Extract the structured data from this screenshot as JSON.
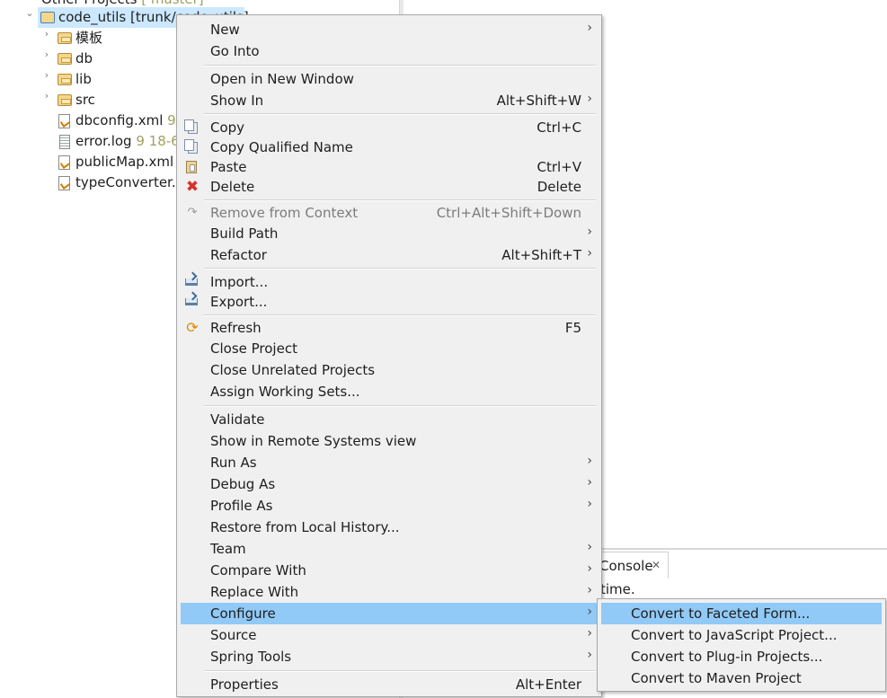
{
  "explorer": {
    "top_row": {
      "label": "Other Projects",
      "deco": "[ master]"
    },
    "project": {
      "label": "code_utils [trunk/code_utils]"
    },
    "items": [
      {
        "label": "模板",
        "deco": "",
        "icon": "folder-icon"
      },
      {
        "label": "db",
        "deco": "",
        "icon": "folder-icon"
      },
      {
        "label": "lib",
        "deco": "",
        "icon": "folder-icon"
      },
      {
        "label": "src",
        "deco": "",
        "icon": "folder-icon"
      },
      {
        "label": "dbconfig.xml",
        "deco": "9",
        "icon": "xml-file-icon"
      },
      {
        "label": "error.log",
        "deco": "9  18-6",
        "icon": "log-file-icon"
      },
      {
        "label": "publicMap.xml",
        "deco": "",
        "icon": "xml-file-icon"
      },
      {
        "label": "typeConverter.xml",
        "deco": "",
        "icon": "xml-file-icon"
      }
    ]
  },
  "console": {
    "tab_label": "Console",
    "close_glyph": "✕",
    "text": "time."
  },
  "menu": {
    "arrow_glyph": "›",
    "items": [
      {
        "label": "New",
        "shortcut": "",
        "submenu": true
      },
      {
        "label": "Go Into",
        "shortcut": ""
      },
      {
        "label": "Open in New Window",
        "shortcut": ""
      },
      {
        "label": "Show In",
        "shortcut": "Alt+Shift+W",
        "submenu": true
      },
      {
        "label": "Copy",
        "shortcut": "Ctrl+C",
        "icon": "copy-icon"
      },
      {
        "label": "Copy Qualified Name",
        "shortcut": "",
        "icon": "copy-icon"
      },
      {
        "label": "Paste",
        "shortcut": "Ctrl+V",
        "icon": "paste-icon"
      },
      {
        "label": "Delete",
        "shortcut": "Delete",
        "icon": "delete-icon"
      },
      {
        "label": "Remove from Context",
        "shortcut": "Ctrl+Alt+Shift+Down",
        "icon": "remove-context-icon",
        "disabled": true
      },
      {
        "label": "Build Path",
        "shortcut": "",
        "submenu": true
      },
      {
        "label": "Refactor",
        "shortcut": "Alt+Shift+T",
        "submenu": true
      },
      {
        "label": "Import...",
        "shortcut": "",
        "icon": "import-icon"
      },
      {
        "label": "Export...",
        "shortcut": "",
        "icon": "export-icon"
      },
      {
        "label": "Refresh",
        "shortcut": "F5",
        "icon": "refresh-icon"
      },
      {
        "label": "Close Project",
        "shortcut": ""
      },
      {
        "label": "Close Unrelated Projects",
        "shortcut": ""
      },
      {
        "label": "Assign Working Sets...",
        "shortcut": ""
      },
      {
        "label": "Validate",
        "shortcut": ""
      },
      {
        "label": "Show in Remote Systems view",
        "shortcut": ""
      },
      {
        "label": "Run As",
        "shortcut": "",
        "submenu": true
      },
      {
        "label": "Debug As",
        "shortcut": "",
        "submenu": true
      },
      {
        "label": "Profile As",
        "shortcut": "",
        "submenu": true
      },
      {
        "label": "Restore from Local History...",
        "shortcut": ""
      },
      {
        "label": "Team",
        "shortcut": "",
        "submenu": true
      },
      {
        "label": "Compare With",
        "shortcut": "",
        "submenu": true
      },
      {
        "label": "Replace With",
        "shortcut": "",
        "submenu": true
      },
      {
        "label": "Configure",
        "shortcut": "",
        "submenu": true,
        "highlighted": true
      },
      {
        "label": "Source",
        "shortcut": "",
        "submenu": true
      },
      {
        "label": "Spring Tools",
        "shortcut": "",
        "submenu": true
      },
      {
        "label": "Properties",
        "shortcut": "Alt+Enter"
      }
    ]
  },
  "submenu": {
    "items": [
      {
        "label": "Convert to Faceted Form...",
        "highlighted": true
      },
      {
        "label": "Convert to JavaScript Project..."
      },
      {
        "label": "Convert to Plug-in Projects..."
      },
      {
        "label": "Convert to Maven Project"
      }
    ]
  },
  "colors": {
    "highlight": "#91c9f7",
    "menu_bg": "#f0f0f0",
    "selection": "#cce8ff"
  }
}
